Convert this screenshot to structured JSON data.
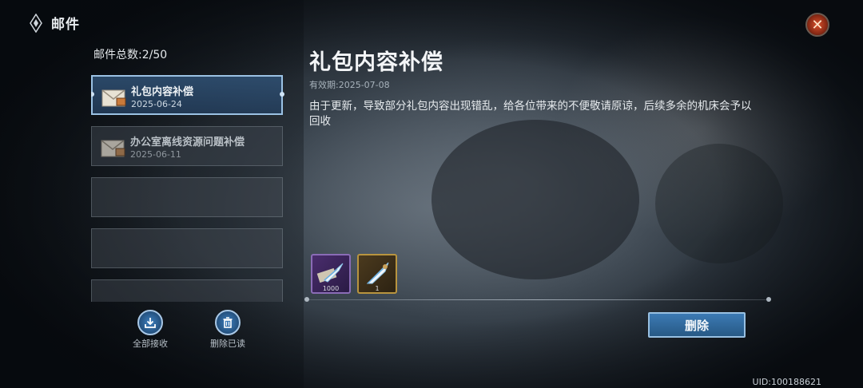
{
  "header": {
    "title": "邮件",
    "close_icon": "close-icon"
  },
  "mail": {
    "count_label": "邮件总数:2/50",
    "items": [
      {
        "title": "礼包内容补偿",
        "date": "2025-06-24",
        "selected": true,
        "read": false
      },
      {
        "title": "办公室离线资源问题补偿",
        "date": "2025-06-11",
        "selected": false,
        "read": true
      }
    ]
  },
  "detail": {
    "title": "礼包内容补偿",
    "expiry": "有效期:2025-07-08",
    "body": "由于更新，导致部分礼包内容出现错乱，给各位带来的不便敬请原谅，后续多余的机床会予以回收",
    "rewards": [
      {
        "icon": "scroll-quill-icon",
        "quantity": "1000",
        "rarity": "purple"
      },
      {
        "icon": "quill-icon",
        "quantity": "1",
        "rarity": "gold"
      }
    ],
    "delete_label": "删除"
  },
  "actions": {
    "receive_all": "全部接收",
    "delete_read": "删除已读"
  },
  "footer": {
    "uid": "UID:100188621"
  },
  "colors": {
    "accent_blue": "#3c7ab4",
    "selected_border": "#9bc2e4",
    "close_red": "#d9502c"
  }
}
